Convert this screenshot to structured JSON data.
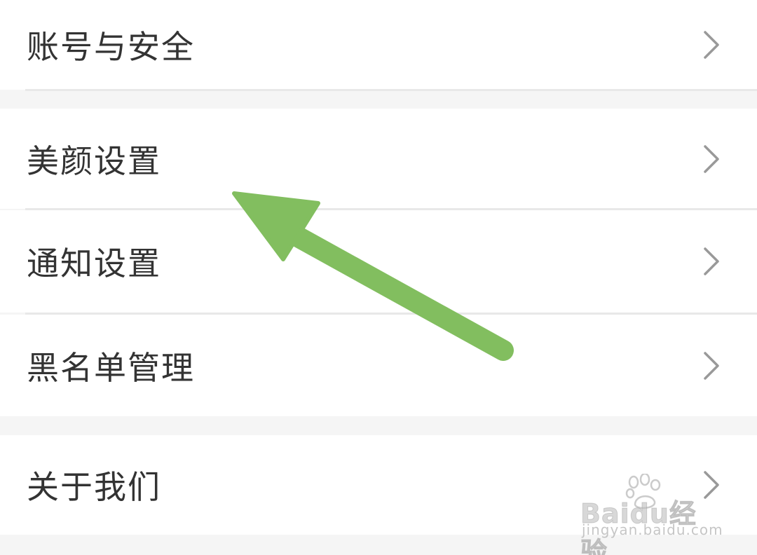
{
  "settings": {
    "items": [
      {
        "label": "账号与安全",
        "icon": "chevron-right-icon"
      },
      {
        "label": "美颜设置",
        "icon": "chevron-right-icon"
      },
      {
        "label": "通知设置",
        "icon": "chevron-right-icon"
      },
      {
        "label": "黑名单管理",
        "icon": "chevron-right-icon"
      },
      {
        "label": "关于我们",
        "icon": "chevron-right-icon"
      }
    ]
  },
  "annotation": {
    "arrow_color": "#82be5f",
    "points_to": "美颜设置"
  },
  "watermark": {
    "logo_text": "Baidu经验",
    "url": "jingyan.baidu.com"
  },
  "colors": {
    "background": "#f5f5f5",
    "row_background": "#ffffff",
    "text": "#333333",
    "chevron": "#999999",
    "divider": "#e8e8e8"
  }
}
